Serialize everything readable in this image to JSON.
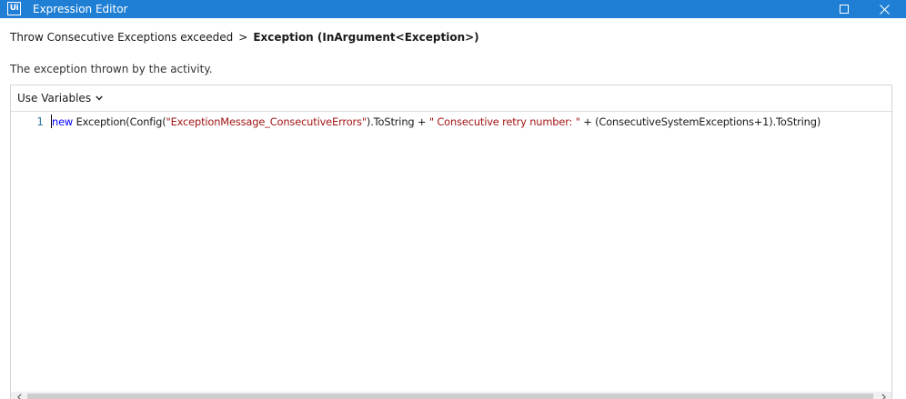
{
  "window": {
    "app_icon_text": "Ui",
    "title": "Expression Editor",
    "title_bar_color": "#1f7fd4",
    "maximize_icon": "maximize-icon",
    "close_icon": "close-icon"
  },
  "breadcrumb": {
    "parent": "Throw Consecutive Exceptions exceeded",
    "separator": ">",
    "current": "Exception (InArgument<Exception>)"
  },
  "description": "The exception thrown by the activity.",
  "toolbar": {
    "use_variables_label": "Use Variables",
    "dropdown_icon": "chevron-down-icon"
  },
  "editor": {
    "line_number": "1",
    "code": {
      "keyword": "new",
      "part1": " Exception(Config(",
      "string1": "\"ExceptionMessage_ConsecutiveErrors\"",
      "part2": ").ToString + ",
      "string2": "\" Consecutive retry number: \"",
      "part3": " + (ConsecutiveSystemExceptions+1).ToString)"
    },
    "colors": {
      "keyword": "#0000ff",
      "string": "#a31515",
      "line_number": "#2b7a9a"
    }
  },
  "scrollbar": {
    "left_icon": "chevron-left-icon",
    "right_icon": "chevron-right-icon"
  }
}
